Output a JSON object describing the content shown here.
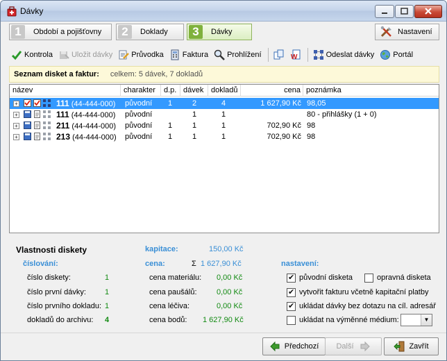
{
  "window": {
    "title": "Dávky"
  },
  "steps": [
    {
      "num": "1",
      "label": "Období a pojišťovny"
    },
    {
      "num": "2",
      "label": "Doklady"
    },
    {
      "num": "3",
      "label": "Dávky"
    }
  ],
  "settings_label": "Nastavení",
  "toolbar": {
    "kontrola": "Kontrola",
    "ulozit": "Uložit dávky",
    "pruvodka": "Průvodka",
    "faktura": "Faktura",
    "prohlizeni": "Prohlížení",
    "odeslat": "Odeslat dávky",
    "portal": "Portál"
  },
  "list": {
    "title": "Seznam disket a faktur:",
    "summary": "celkem: 5 dávek, 7 dokladů",
    "columns": {
      "nazev": "název",
      "charakter": "charakter",
      "dp": "d.p.",
      "davek": "dávek",
      "dokladu": "dokladů",
      "cena": "cena",
      "poznamka": "poznámka"
    },
    "rows": [
      {
        "num": "111",
        "code": "(44-444-000)",
        "charakter": "původní",
        "dp": "1",
        "davek": "2",
        "dokladu": "4",
        "cena": "1 627,90 Kč",
        "poznamka": "98,05"
      },
      {
        "num": "111",
        "code": "(44-444-000)",
        "charakter": "původní",
        "dp": "",
        "davek": "1",
        "dokladu": "1",
        "cena": "",
        "poznamka": "80 - přihlášky (1 + 0)"
      },
      {
        "num": "211",
        "code": "(44-444-000)",
        "charakter": "původní",
        "dp": "1",
        "davek": "1",
        "dokladu": "1",
        "cena": "702,90 Kč",
        "poznamka": "98"
      },
      {
        "num": "213",
        "code": "(44-444-000)",
        "charakter": "původní",
        "dp": "1",
        "davek": "1",
        "dokladu": "1",
        "cena": "702,90 Kč",
        "poznamka": "98"
      }
    ]
  },
  "props": {
    "title": "Vlastnosti diskety",
    "cislovani_h": "číslování:",
    "cislo_diskety_l": "číslo diskety:",
    "cislo_diskety_v": "1",
    "cislo_prvni_davky_l": "číslo první dávky:",
    "cislo_prvni_davky_v": "1",
    "cislo_prvniho_dokladu_l": "číslo prvního dokladu:",
    "cislo_prvniho_dokladu_v": "1",
    "dokladu_archivu_l": "dokladů do archivu:",
    "dokladu_archivu_v": "4",
    "kapitace_h": "kapitace:",
    "kapitace_v": "150,00 Kč",
    "cena_h": "cena:",
    "cena_sigma": "Σ",
    "cena_v": "1 627,90 Kč",
    "cena_materialu_l": "cena materiálu:",
    "cena_materialu_v": "0,00 Kč",
    "cena_pausalu_l": "cena paušálů:",
    "cena_pausalu_v": "0,00 Kč",
    "cena_leciva_l": "cena léčiva:",
    "cena_leciva_v": "0,00 Kč",
    "cena_bodu_l": "cena bodů:",
    "cena_bodu_v": "1 627,90 Kč",
    "nastaveni_h": "nastavení:",
    "puvodni_disketa": "původní disketa",
    "opravna_disketa": "opravná disketa",
    "vytvorit_fakturu": "vytvořit fakturu včetně kapitační platby",
    "ukladat_davky": "ukládat dávky bez dotazu na cíl. adresář",
    "ukladat_medium": "ukládat na výměnné médium:",
    "checks": {
      "puvodni": true,
      "opravna": false,
      "vytvorit": true,
      "ukladat": true,
      "medium": false
    }
  },
  "buttons": {
    "predchozi": "Předchozí",
    "dalsi": "Další",
    "zavrit": "Zavřít"
  },
  "colors": {
    "selection": "#3399ff",
    "green_value": "#128a12",
    "blue_heading": "#3a8fd6",
    "active_step": "#7fb13c"
  }
}
